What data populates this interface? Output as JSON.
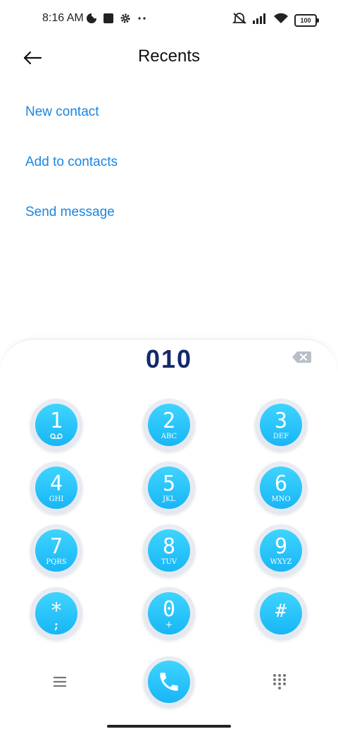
{
  "status_bar": {
    "time": "8:16 AM",
    "battery": "100",
    "icons_left": [
      "data-saver-icon",
      "square-notification-icon",
      "settings-gear-icon",
      "more-dots-icon"
    ],
    "icons_right": [
      "mute-icon",
      "signal-icon",
      "wifi-icon",
      "battery-icon"
    ]
  },
  "header": {
    "title": "Recents"
  },
  "actions": [
    {
      "label": "New contact"
    },
    {
      "label": "Add to contacts"
    },
    {
      "label": "Send message"
    }
  ],
  "dialpad": {
    "entered_number": "010",
    "keys": [
      {
        "digit": "1",
        "letters": ""
      },
      {
        "digit": "2",
        "letters": "ABC"
      },
      {
        "digit": "3",
        "letters": "DEF"
      },
      {
        "digit": "4",
        "letters": "GHI"
      },
      {
        "digit": "5",
        "letters": "JKL"
      },
      {
        "digit": "6",
        "letters": "MNO"
      },
      {
        "digit": "7",
        "letters": "PQRS"
      },
      {
        "digit": "8",
        "letters": "TUV"
      },
      {
        "digit": "9",
        "letters": "WXYZ"
      },
      {
        "digit": "*",
        "letters": ";"
      },
      {
        "digit": "0",
        "letters": "+"
      },
      {
        "digit": "#",
        "letters": ""
      }
    ]
  },
  "colors": {
    "accent": "#1a86e0",
    "key_blue": "#18b6f5",
    "number_text": "#13296b"
  }
}
